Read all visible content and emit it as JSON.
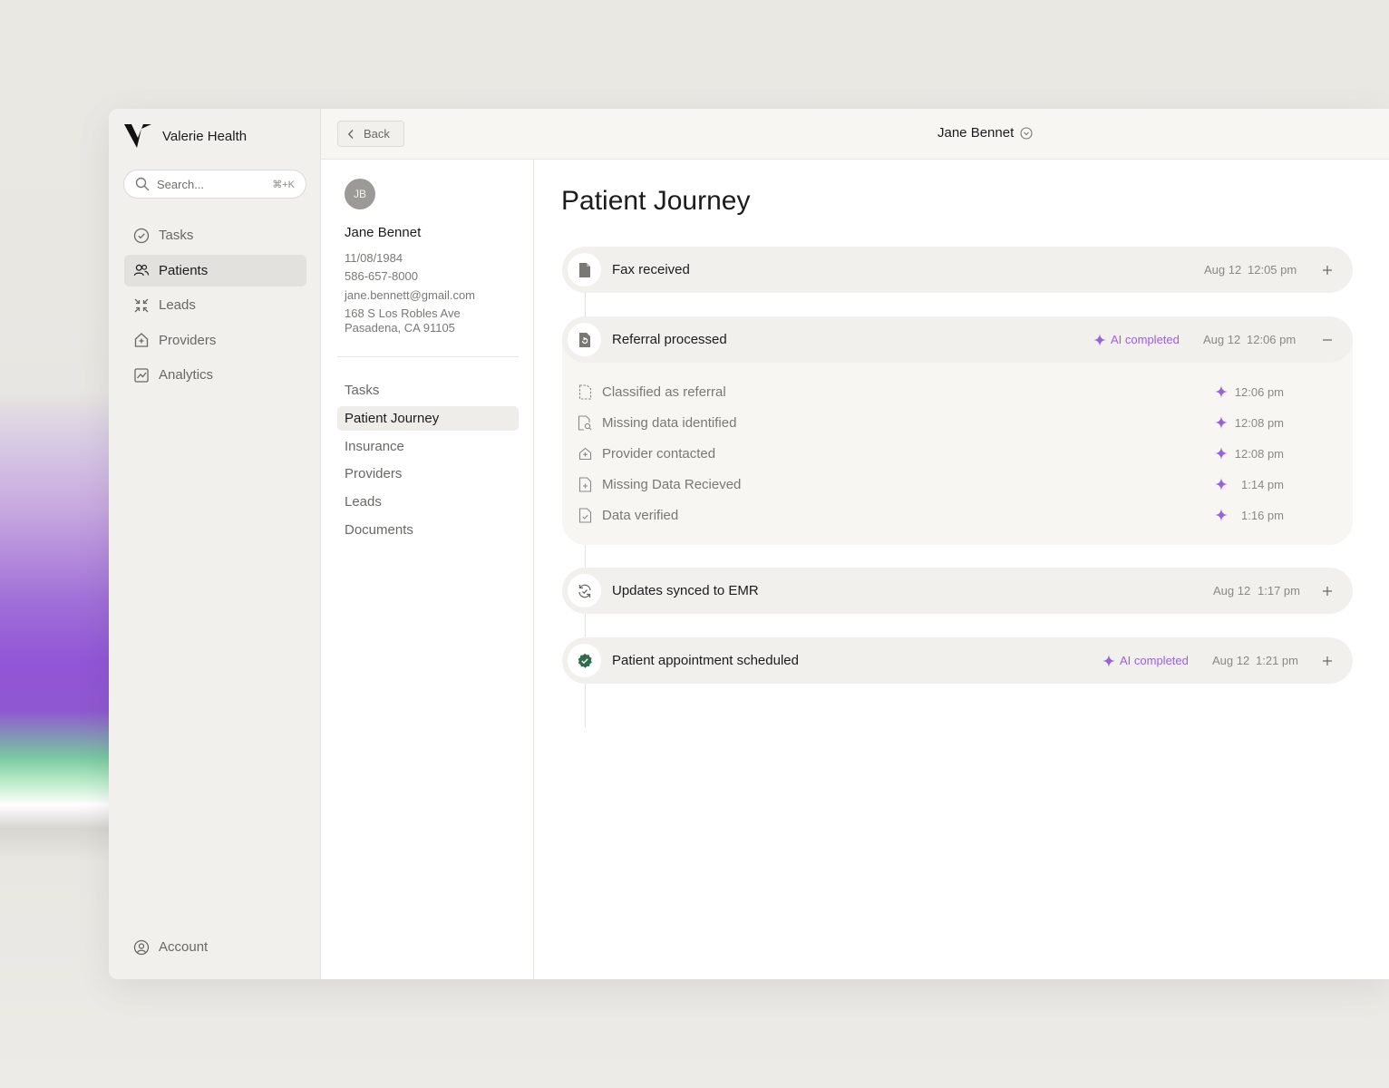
{
  "app": {
    "name": "Valerie Health"
  },
  "search": {
    "placeholder": "Search...",
    "shortcut": "⌘+K"
  },
  "sidebar": {
    "items": [
      {
        "label": "Tasks",
        "icon": "check-circle-icon"
      },
      {
        "label": "Patients",
        "icon": "users-icon",
        "active": true
      },
      {
        "label": "Leads",
        "icon": "arrows-in-icon"
      },
      {
        "label": "Providers",
        "icon": "hospital-icon"
      },
      {
        "label": "Analytics",
        "icon": "chart-icon"
      }
    ],
    "account_label": "Account"
  },
  "topbar": {
    "back_label": "Back",
    "title": "Jane Bennet"
  },
  "patient": {
    "initials": "JB",
    "name": "Jane Bennet",
    "dob": "11/08/1984",
    "phone": "586-657-8000",
    "email": "jane.bennett@gmail.com",
    "address_line1": "168 S Los Robles Ave",
    "address_line2": "Pasadena, CA 91105"
  },
  "patient_nav": {
    "items": [
      "Tasks",
      "Patient Journey",
      "Insurance",
      "Providers",
      "Leads",
      "Documents"
    ],
    "active": "Patient Journey"
  },
  "main": {
    "title": "Patient Journey",
    "events": [
      {
        "label": "Fax received",
        "icon": "document-icon",
        "date": "Aug 12",
        "time": "12:05 pm",
        "ai": "",
        "toggle": "+"
      },
      {
        "label": "Referral processed",
        "icon": "refresh-document-icon",
        "date": "Aug 12",
        "time": "12:06 pm",
        "ai": "AI completed",
        "toggle": "−",
        "steps": [
          {
            "label": "Classified as referral",
            "icon": "dashed-document-icon",
            "time": "12:06 pm"
          },
          {
            "label": "Missing data identified",
            "icon": "search-document-icon",
            "time": "12:08 pm"
          },
          {
            "label": "Provider contacted",
            "icon": "hospital-icon",
            "time": "12:08 pm"
          },
          {
            "label": "Missing Data Recieved",
            "icon": "plus-document-icon",
            "time": "1:14 pm"
          },
          {
            "label": "Data verified",
            "icon": "check-document-icon",
            "time": "1:16 pm"
          }
        ]
      },
      {
        "label": "Updates synced to EMR",
        "icon": "sync-icon",
        "date": "Aug 12",
        "time": "1:17 pm",
        "ai": "",
        "toggle": "+"
      },
      {
        "label": "Patient appointment scheduled",
        "icon": "check-badge-icon",
        "date": "Aug 12",
        "time": "1:21 pm",
        "ai": "AI completed",
        "toggle": "+"
      }
    ]
  },
  "colors": {
    "accent_ai": "#9a62d8",
    "check_green": "#2f6b4f",
    "sidebar_bg": "#f1f0ed"
  }
}
